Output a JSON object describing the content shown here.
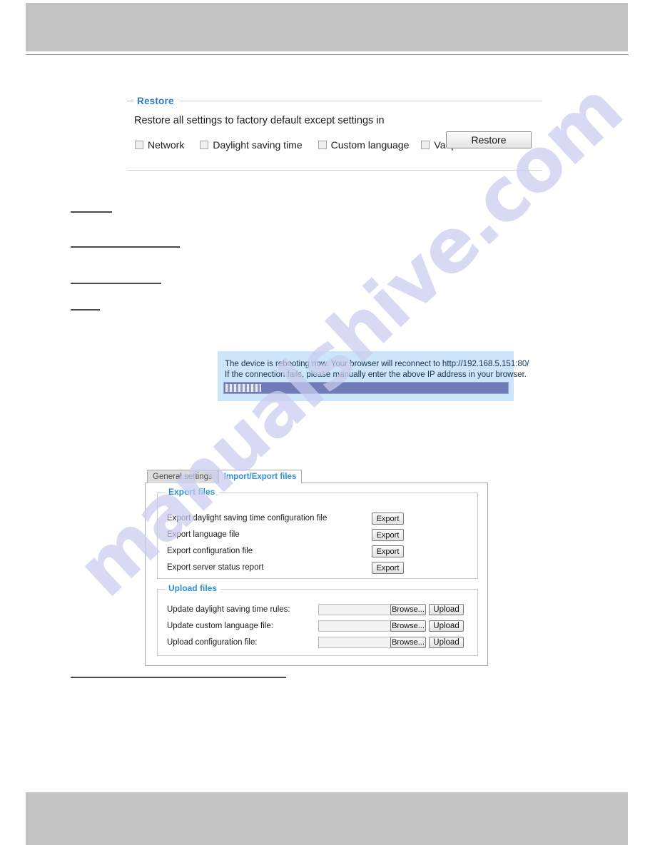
{
  "page": {
    "watermark": "manualshive.com"
  },
  "restore_panel": {
    "legend": "Restore",
    "description": "Restore all settings to factory default except settings in",
    "options": [
      {
        "label": "Network",
        "checked": false
      },
      {
        "label": "Daylight saving time",
        "checked": false
      },
      {
        "label": "Custom language",
        "checked": false
      },
      {
        "label": "Vadp",
        "checked": false
      }
    ],
    "restore_button": "Restore"
  },
  "reboot_dialog": {
    "line1": "The device is rebooting now. Your browser will reconnect to http://192.168.5.151:80/",
    "line2": "If the connection fails, please manually enter the above IP address in your browser.",
    "progress_percent": 12,
    "background_color": "#cde5fa",
    "progress_track_color": "#6f7cb8"
  },
  "import_export": {
    "tabs": [
      {
        "label": "General settings",
        "active": false
      },
      {
        "label": "Import/Export files",
        "active": true
      }
    ],
    "export_section": {
      "legend": "Export files",
      "rows": [
        {
          "label": "Export daylight saving time configuration file",
          "button": "Export"
        },
        {
          "label": "Export language file",
          "button": "Export"
        },
        {
          "label": "Export configuration file",
          "button": "Export"
        },
        {
          "label": "Export server status report",
          "button": "Export"
        }
      ]
    },
    "upload_section": {
      "legend": "Upload files",
      "rows": [
        {
          "label": "Update daylight saving time rules:",
          "value": "",
          "browse": "Browse...",
          "upload": "Upload"
        },
        {
          "label": "Update custom language file:",
          "value": "",
          "browse": "Browse...",
          "upload": "Upload"
        },
        {
          "label": "Upload configuration file:",
          "value": "",
          "browse": "Browse...",
          "upload": "Upload"
        }
      ]
    }
  },
  "colors": {
    "accent_blue": "#2f8fd8",
    "legend_blue": "#2f79c4",
    "chrome_gray": "#c3c3c3",
    "watermark": "#c9cdee"
  }
}
